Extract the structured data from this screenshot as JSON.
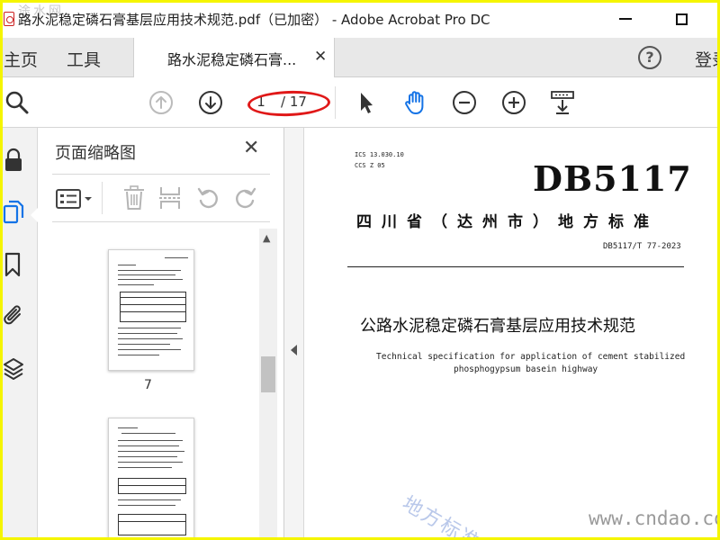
{
  "window": {
    "title": "路水泥稳定磷石膏基层应用技术规范.pdf（已加密） - Adobe Acrobat Pro DC",
    "top_watermark": "途水网"
  },
  "tabs": {
    "home": "主页",
    "tools": "工具",
    "document": "路水泥稳定磷石膏...",
    "login": "登录"
  },
  "toolbar": {
    "current_page": "1",
    "page_total": "/ 17"
  },
  "thumbnail_panel": {
    "title": "页面缩略图",
    "visible_page_label": "7"
  },
  "document": {
    "ics": "ICS 13.030.10",
    "ccs": "CCS Z 05",
    "db_code": "DB5117",
    "region": "四川省（达州市）地方标准",
    "standard_number": "DB5117/T 77-2023",
    "title_cn": "公路水泥稳定磷石膏基层应用技术规范",
    "title_en_line1": "Technical specification for application of cement stabilized",
    "title_en_line2": "phosphogypsum basein highway"
  },
  "watermarks": {
    "diagonal": "地方标准信",
    "site": "www.cndao.com"
  },
  "colors": {
    "accent_blue": "#1473e6",
    "highlight_red": "#e01818",
    "frame_yellow": "#f5f500"
  },
  "icons": {
    "toolbar": [
      "search-icon",
      "previous-page-icon",
      "next-page-icon",
      "select-arrow-icon",
      "hand-icon",
      "zoom-out-icon",
      "zoom-in-icon",
      "page-display-icon"
    ],
    "rail": [
      "lock-icon",
      "pages-icon",
      "bookmark-icon",
      "attachment-icon",
      "layers-icon"
    ],
    "panel": [
      "options-icon",
      "delete-icon",
      "extract-icon",
      "rotate-left-icon",
      "rotate-right-icon"
    ]
  }
}
